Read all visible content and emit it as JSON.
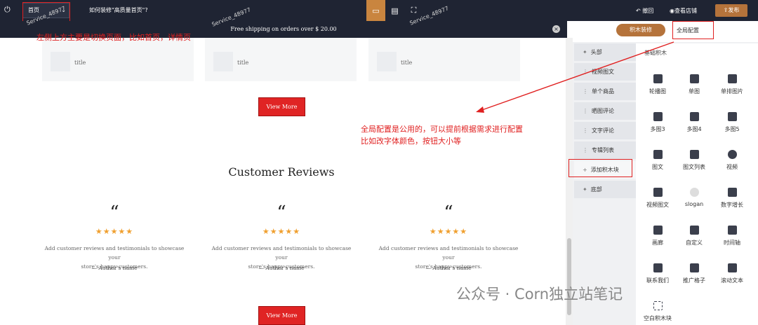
{
  "topbar": {
    "page_select": "首页",
    "help_link": "如何装修\"高质量首页\"?",
    "undo": "撤回",
    "view_store": "查看店铺",
    "publish": "发布"
  },
  "shipping_bar": {
    "text": "Free shipping on orders over $ 20.00"
  },
  "annotations": {
    "note1": "左侧上方主要是切换页面，比如首页，详情页",
    "note2_line1": "全局配置是公用的，可以提前根据需求进行配置",
    "note2_line2": "比如改字体颜色，按钮大小等"
  },
  "cards": [
    {
      "title": "title"
    },
    {
      "title": "title"
    },
    {
      "title": "title"
    }
  ],
  "view_more": "View More",
  "reviews": {
    "heading": "Customer Reviews",
    "stars": "★★★★★",
    "quote": "“",
    "items": [
      {
        "text1": "Add customer reviews and testimonials to showcase your",
        "text2": "store's happy customers.",
        "author": "— Author's name"
      },
      {
        "text1": "Add customer reviews and testimonials to showcase your",
        "text2": "store's happy customers.",
        "author": "— Author's name"
      },
      {
        "text1": "Add customer reviews and testimonials to showcase your",
        "text2": "store's happy customers.",
        "author": "— Author's name"
      }
    ]
  },
  "panel": {
    "tab_blocks": "积木装修",
    "tab_global": "全局配置",
    "sections": [
      "头部",
      "视频图文",
      "单个商品",
      "晒图评论",
      "文字评论",
      "专辑列表",
      "添加积木块",
      "底部"
    ],
    "grid_header": "基础积木",
    "items": [
      "轮播图",
      "单图",
      "单排图片",
      "多图3",
      "多图4",
      "多图5",
      "图文",
      "图文列表",
      "视频",
      "视频图文",
      "slogan",
      "数字增长",
      "画廊",
      "自定义",
      "时间轴",
      "联系我们",
      "推广格子",
      "滚动文本",
      "空白积木块"
    ]
  },
  "watermark": "公众号 · Corn独立站笔记",
  "watermark_small": "Service_48977",
  "colors": {
    "topbar": "#1f2433",
    "accent": "#b5733b",
    "annotation": "#e02020",
    "button": "#e02424"
  }
}
